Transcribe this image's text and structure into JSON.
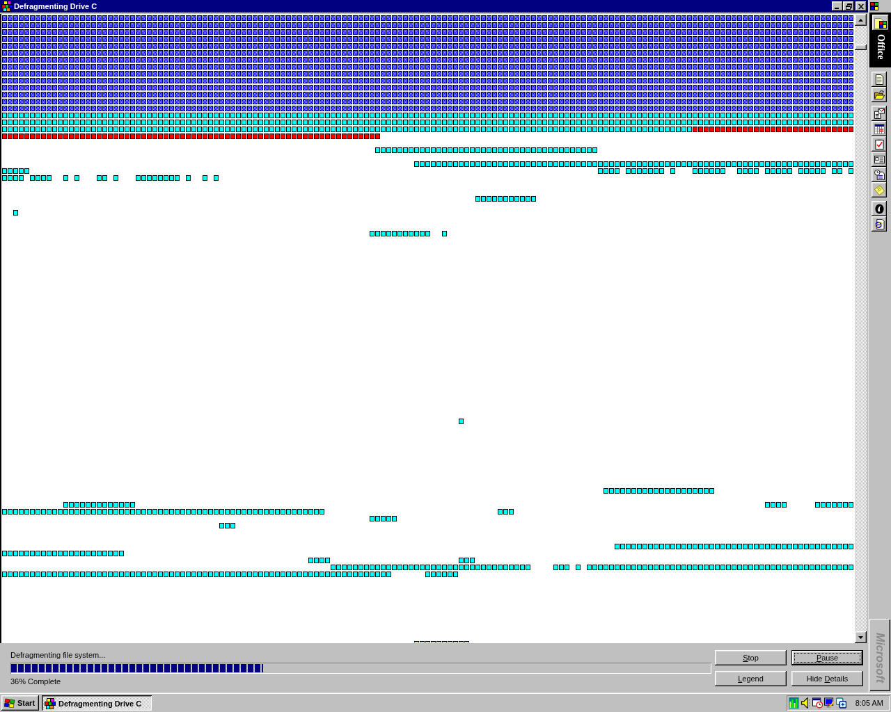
{
  "window": {
    "title": "Defragmenting Drive C"
  },
  "status": {
    "message": "Defragmenting file system...",
    "progress": {
      "level": 0.36
    },
    "percent_text": "36% Complete"
  },
  "buttons": [
    {
      "mnemonic": "S",
      "after": "top",
      "focused": false
    },
    {
      "mnemonic": "P",
      "after": "ause",
      "focused": true
    },
    {
      "mnemonic": "L",
      "after": "egend",
      "focused": false
    },
    {
      "before": "Hide ",
      "mnemonic": "D",
      "after": "etails",
      "focused": false
    }
  ],
  "office_bar": {
    "title": "Office",
    "brand": "Microsoft"
  },
  "taskbar": {
    "start": "Start",
    "tasks": [
      {
        "label": "Defragmenting Drive C",
        "selected": true
      }
    ],
    "clock": "8:05 AM"
  }
}
